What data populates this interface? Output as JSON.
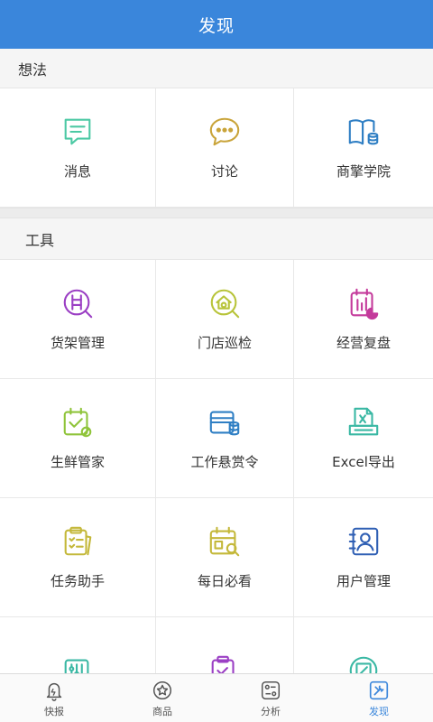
{
  "header": {
    "title": "发现"
  },
  "sections": {
    "ideas": {
      "title": "想法",
      "items": [
        {
          "label": "消息",
          "icon": "message-icon",
          "color": "#4cc9a4"
        },
        {
          "label": "讨论",
          "icon": "discussion-icon",
          "color": "#c9a43a"
        },
        {
          "label": "商擎学院",
          "icon": "book-icon",
          "color": "#2f7fc4"
        }
      ]
    },
    "tools": {
      "title": "工具",
      "items": [
        {
          "label": "货架管理",
          "icon": "shelf-icon",
          "color": "#9b3fc4"
        },
        {
          "label": "门店巡检",
          "icon": "store-inspection-icon",
          "color": "#b8c43a"
        },
        {
          "label": "经营复盘",
          "icon": "business-review-icon",
          "color": "#c43a9b"
        },
        {
          "label": "生鲜管家",
          "icon": "fresh-calendar-icon",
          "color": "#8fc43a"
        },
        {
          "label": "工作悬赏令",
          "icon": "wallet-icon",
          "color": "#2f7fc4"
        },
        {
          "label": "Excel导出",
          "icon": "excel-export-icon",
          "color": "#3ab8a4"
        },
        {
          "label": "任务助手",
          "icon": "task-clipboard-icon",
          "color": "#c4b83a"
        },
        {
          "label": "每日必看",
          "icon": "daily-calendar-icon",
          "color": "#c4b83a"
        },
        {
          "label": "用户管理",
          "icon": "user-card-icon",
          "color": "#2f5fb4"
        },
        {
          "label": "",
          "icon": "settings-sliders-icon",
          "color": "#3ab8a4"
        },
        {
          "label": "",
          "icon": "clipboard-check-icon",
          "color": "#9b3fc4"
        },
        {
          "label": "",
          "icon": "edit-circle-icon",
          "color": "#3ab8a4"
        }
      ]
    }
  },
  "tabbar": {
    "items": [
      {
        "label": "快报",
        "icon": "bell-icon",
        "active": false
      },
      {
        "label": "商品",
        "icon": "star-circle-icon",
        "active": false
      },
      {
        "label": "分析",
        "icon": "analysis-icon",
        "active": false
      },
      {
        "label": "发现",
        "icon": "tools-icon",
        "active": true
      }
    ],
    "active_color": "#3a86db"
  }
}
